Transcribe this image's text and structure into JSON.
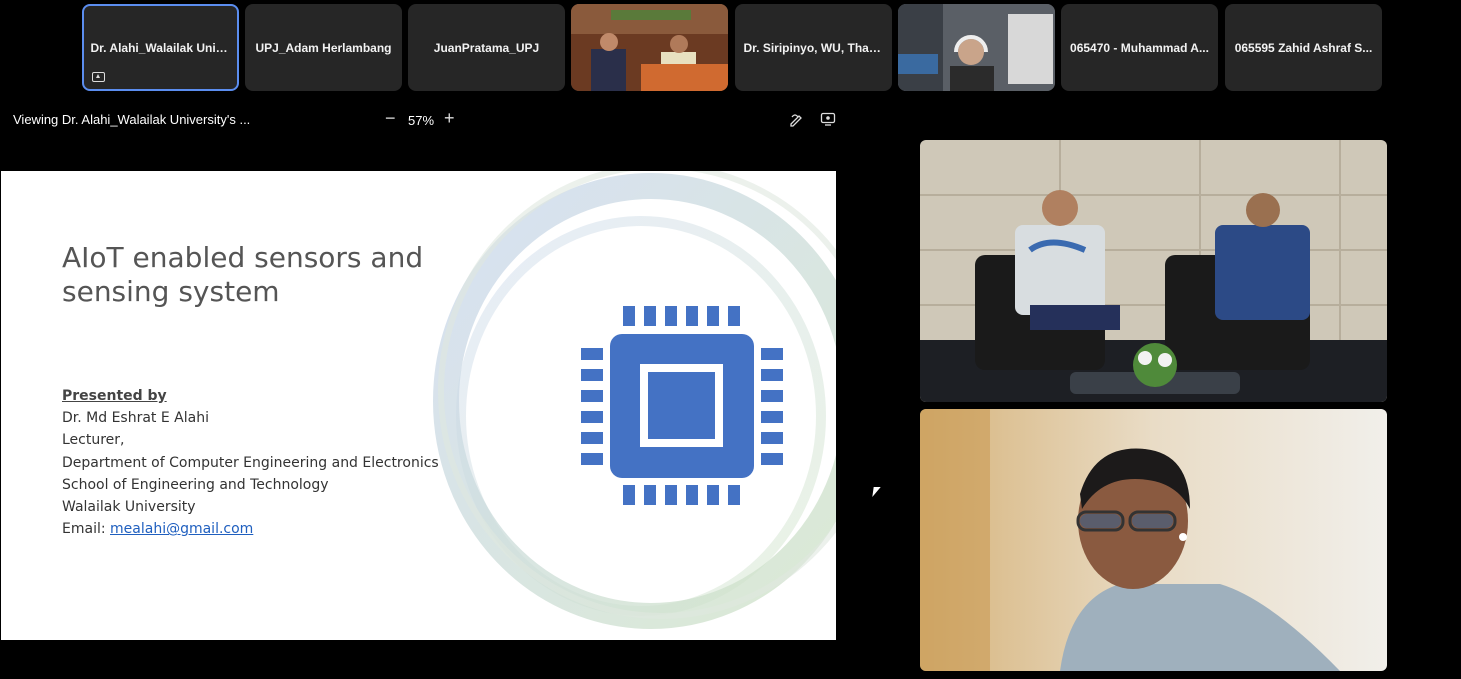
{
  "participants": [
    {
      "name": "Dr. Alahi_Walailak Univ...",
      "active": true
    },
    {
      "name": "UPJ_Adam Herlambang"
    },
    {
      "name": "JuanPratama_UPJ"
    },
    {
      "name": "",
      "video": "panel-video"
    },
    {
      "name": "Dr. Siripinyo, WU, Thail..."
    },
    {
      "name": "",
      "video": "webcam-video"
    },
    {
      "name": "065470 - Muhammad A..."
    },
    {
      "name": "065595 Zahid Ashraf S..."
    }
  ],
  "toolbar": {
    "viewing_label": "Viewing Dr. Alahi_Walailak University's ...",
    "zoom_minus": "−",
    "zoom_level": "57%",
    "zoom_plus": "+"
  },
  "slide": {
    "title": "AIoT enabled sensors and sensing system",
    "presented_by": "Presented by",
    "presenter": "Dr. Md Eshrat E Alahi",
    "role": "Lecturer,",
    "department": "Department of Computer Engineering and Electronics",
    "school": "School of Engineering and Technology",
    "university": "Walailak University",
    "email_label": "Email: ",
    "email": "mealahi@gmail.com",
    "accent_color": "#4472c4"
  },
  "icons": {
    "annotate": "annotate-icon",
    "share_screen": "share-screen-icon",
    "chip": "chip-icon"
  }
}
